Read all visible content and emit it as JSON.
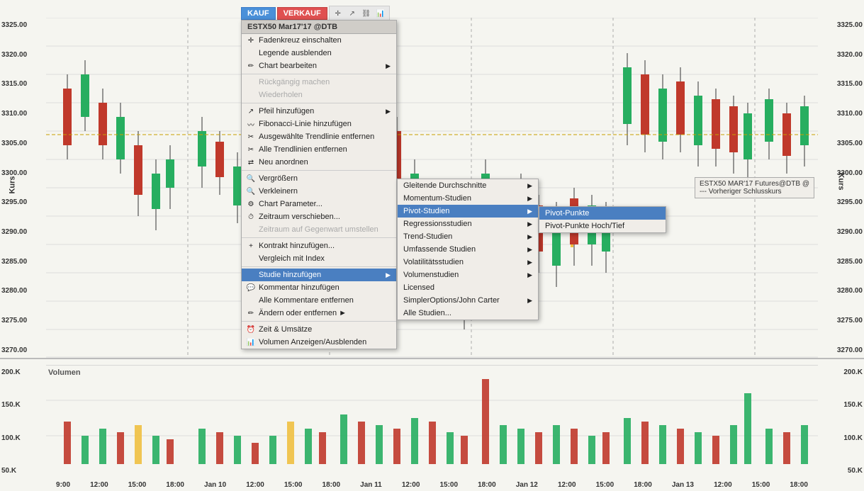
{
  "toolbar": {
    "kauf_label": "KAUF",
    "verkauf_label": "VERKAUF",
    "title": "ESTX50 Mar17'17 @DTB"
  },
  "context_menu": {
    "title": "ESTX50 Mar17'17 @DTB",
    "items": [
      {
        "label": "Fadenkreuz einschalten",
        "has_icon": true,
        "enabled": true,
        "has_submenu": false
      },
      {
        "label": "Legende ausblenden",
        "has_icon": false,
        "enabled": true,
        "has_submenu": false
      },
      {
        "label": "Chart bearbeiten",
        "has_icon": true,
        "enabled": true,
        "has_submenu": true
      },
      {
        "label": "Rückgängig machen",
        "has_icon": false,
        "enabled": false,
        "has_submenu": false
      },
      {
        "label": "Wiederholen",
        "has_icon": false,
        "enabled": false,
        "has_submenu": false
      },
      {
        "label": "Pfeil hinzufügen",
        "has_icon": true,
        "enabled": true,
        "has_submenu": true
      },
      {
        "label": "Fibonacci-Linie hinzufügen",
        "has_icon": true,
        "enabled": true,
        "has_submenu": false
      },
      {
        "label": "Ausgewählte Trendlinie entfernen",
        "has_icon": true,
        "enabled": true,
        "has_submenu": false
      },
      {
        "label": "Alle Trendlinien entfernen",
        "has_icon": true,
        "enabled": true,
        "has_submenu": false
      },
      {
        "label": "Neu anordnen",
        "has_icon": true,
        "enabled": true,
        "has_submenu": false
      },
      {
        "label": "Vergrößern",
        "has_icon": true,
        "enabled": true,
        "has_submenu": false
      },
      {
        "label": "Verkleinern",
        "has_icon": true,
        "enabled": true,
        "has_submenu": false
      },
      {
        "label": "Chart Parameter...",
        "has_icon": true,
        "enabled": true,
        "has_submenu": false
      },
      {
        "label": "Zeitraum verschieben...",
        "has_icon": true,
        "enabled": true,
        "has_submenu": false
      },
      {
        "label": "Zeitraum auf Gegenwart umstellen",
        "has_icon": false,
        "enabled": false,
        "has_submenu": false
      },
      {
        "label": "Kontrakt hinzufügen...",
        "has_icon": true,
        "enabled": true,
        "has_submenu": false
      },
      {
        "label": "Vergleich mit Index",
        "has_icon": false,
        "enabled": true,
        "has_submenu": false
      },
      {
        "label": "Studie hinzufügen",
        "has_icon": false,
        "enabled": true,
        "has_submenu": true,
        "highlighted": true
      },
      {
        "label": "Kommentar hinzufügen",
        "has_icon": true,
        "enabled": true,
        "has_submenu": false
      },
      {
        "label": "Alle Kommentare entfernen",
        "has_icon": false,
        "enabled": true,
        "has_submenu": false
      },
      {
        "label": "Ändern oder entfernen ►",
        "has_icon": true,
        "enabled": true,
        "has_submenu": true
      },
      {
        "label": "Zeit & Umsätze",
        "has_icon": true,
        "enabled": true,
        "has_submenu": false
      },
      {
        "label": "Volumen Anzeigen/Ausblenden",
        "has_icon": true,
        "enabled": true,
        "has_submenu": false
      }
    ]
  },
  "submenu_studie": {
    "items": [
      {
        "label": "Gleitende Durchschnitte",
        "has_submenu": true
      },
      {
        "label": "Momentum-Studien",
        "has_submenu": true
      },
      {
        "label": "Pivot-Studien",
        "has_submenu": true,
        "highlighted": true
      },
      {
        "label": "Regressionsstudien",
        "has_submenu": true
      },
      {
        "label": "Trend-Studien",
        "has_submenu": true
      },
      {
        "label": "Umfassende Studien",
        "has_submenu": true
      },
      {
        "label": "Volatilitätsstudien",
        "has_submenu": true
      },
      {
        "label": "Volumenstudien",
        "has_submenu": true
      },
      {
        "label": "Licensed",
        "has_submenu": false
      },
      {
        "label": "SimplerOptions/John Carter",
        "has_submenu": true
      },
      {
        "label": "Alle Studien...",
        "has_submenu": false
      }
    ]
  },
  "submenu_pivot": {
    "items": [
      {
        "label": "Pivot-Punkte",
        "highlighted": true
      },
      {
        "label": "Pivot-Punkte Hoch/Tief",
        "highlighted": false
      }
    ]
  },
  "chart": {
    "y_labels": [
      "3325.00",
      "3320.00",
      "3315.00",
      "3310.00",
      "3305.00",
      "3300.00",
      "3295.00",
      "3290.00",
      "3285.00",
      "3280.00",
      "3275.00",
      "3270.00"
    ],
    "vol_labels": [
      "200.K",
      "150.K",
      "100.K",
      "50.K"
    ],
    "time_labels": [
      "9:00",
      "12:00",
      "15:00",
      "18:00",
      "Jan 10",
      "12:00",
      "15:00",
      "18:00",
      "Jan 11",
      "12:00",
      "15:00",
      "18:00",
      "Jan 12",
      "12:00",
      "15:00",
      "18:00",
      "Jan 13",
      "12:00",
      "15:00",
      "18:00"
    ],
    "kurs_text": "Kurs",
    "volumen_text": "Volumen",
    "legend_title": "ESTX50 MAR'17 Futures@DTB @",
    "legend_subtitle": "--- Vorheriger Schlusskurs"
  }
}
